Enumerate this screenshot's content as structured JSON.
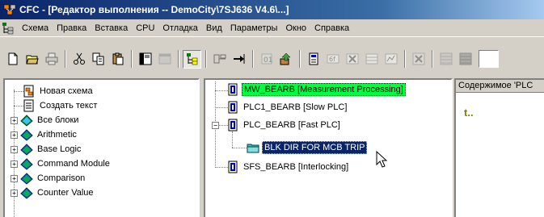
{
  "window": {
    "title": "CFC - [Редактор выполнения -- DemoCity\\7SJ636 V4.6\\...]"
  },
  "menu": {
    "items": [
      "Схема",
      "Правка",
      "Вставка",
      "CPU",
      "Отладка",
      "Вид",
      "Параметры",
      "Окно",
      "Справка"
    ]
  },
  "toolbar": {
    "buttons": [
      "new-icon",
      "open-icon",
      "print-icon",
      "cut-icon",
      "copy-icon",
      "paste-icon",
      "block-icon",
      "sheet-icon",
      "tree-icon",
      "connect-icon",
      "run-sequence-icon",
      "optimize-icon",
      "insert-icon",
      "compile-icon",
      "delete-icon",
      "table-icon",
      "close-icon",
      "grid-icon",
      "grid-dark-icon"
    ]
  },
  "left_tree": {
    "items": [
      {
        "label": "Новая схема",
        "icon": "new-chart-icon"
      },
      {
        "label": "Создать текст",
        "icon": "text-icon"
      },
      {
        "label": "Все блоки",
        "icon": "folder-icon"
      },
      {
        "label": "Arithmetic",
        "icon": "folder-icon"
      },
      {
        "label": "Base Logic",
        "icon": "folder-icon"
      },
      {
        "label": "Command Module",
        "icon": "folder-icon"
      },
      {
        "label": "Comparison",
        "icon": "folder-icon"
      },
      {
        "label": "Counter Value",
        "icon": "folder-icon"
      }
    ]
  },
  "mid_tree": {
    "items": [
      {
        "label": "MW_BEARB [Measurement Processing]",
        "icon": "task-icon",
        "highlight": "green"
      },
      {
        "label": "PLC1_BEARB [Slow PLC]",
        "icon": "task-icon"
      },
      {
        "label": "PLC_BEARB [Fast PLC]",
        "icon": "task-icon"
      },
      {
        "label": "BLK DIR FOR MCB TRIP",
        "icon": "chart-folder-icon",
        "highlight": "selected"
      },
      {
        "label": "SFS_BEARB [Interlocking]",
        "icon": "task-icon"
      }
    ]
  },
  "right_pane": {
    "header": "Содержимое 'PLC",
    "up_symbol": "t.."
  },
  "colors": {
    "title_start": "#0a246a",
    "title_end": "#a6caf0",
    "highlight_green": "#00ff40",
    "selection": "#0a246a",
    "window_bg": "#d4d0c8"
  }
}
